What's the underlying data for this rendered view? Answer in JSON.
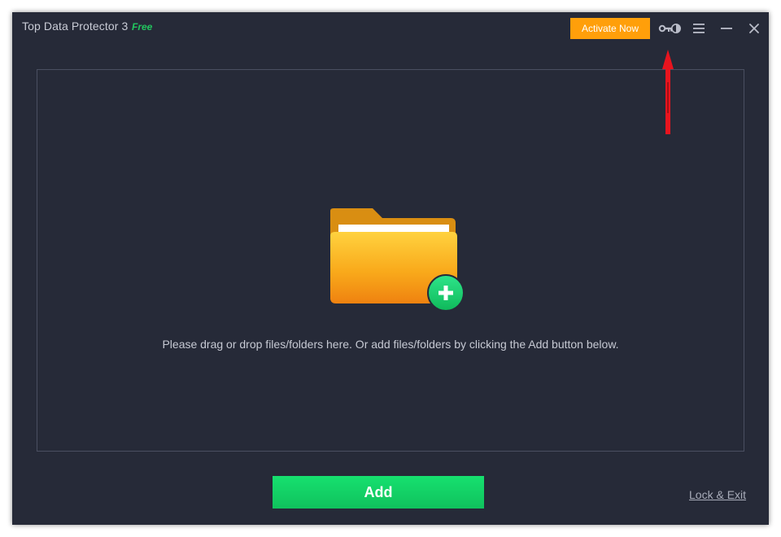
{
  "titlebar": {
    "app_name": "Top Data Protector 3",
    "edition_badge": "Free",
    "activate_label": "Activate Now",
    "icons": [
      "key-toggle-icon",
      "menu-icon",
      "minimize-icon",
      "close-icon"
    ]
  },
  "drop_zone": {
    "hint": "Please drag or drop files/folders here. Or add files/folders by clicking the Add button below.",
    "icon": "folder-add-icon"
  },
  "footer": {
    "add_label": "Add",
    "lock_exit_label": "Lock & Exit"
  },
  "colors": {
    "background": "#262a38",
    "accent_orange": "#ff9f0a",
    "accent_green": "#14d468",
    "annotation_red": "#e8141e"
  }
}
